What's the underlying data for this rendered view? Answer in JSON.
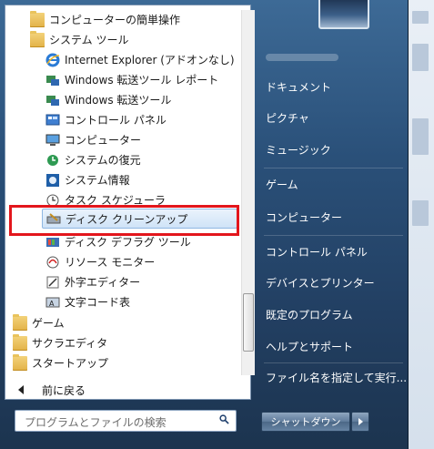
{
  "programs": {
    "items": [
      {
        "label": "コンピューターの簡単操作",
        "icon": "folder-icon"
      },
      {
        "label": "システム ツール",
        "icon": "folder-icon"
      },
      {
        "label": "Internet Explorer (アドオンなし)",
        "icon": "internet-explorer-icon"
      },
      {
        "label": "Windows 転送ツール レポート",
        "icon": "transfer-report-icon"
      },
      {
        "label": "Windows 転送ツール",
        "icon": "transfer-tool-icon"
      },
      {
        "label": "コントロール パネル",
        "icon": "control-panel-icon"
      },
      {
        "label": "コンピューター",
        "icon": "computer-icon"
      },
      {
        "label": "システムの復元",
        "icon": "system-restore-icon"
      },
      {
        "label": "システム情報",
        "icon": "system-info-icon"
      },
      {
        "label": "タスク スケジューラ",
        "icon": "task-scheduler-icon"
      },
      {
        "label": "ディスク クリーンアップ",
        "icon": "disk-cleanup-icon"
      },
      {
        "label": "ディスク デフラグ ツール",
        "icon": "defrag-icon"
      },
      {
        "label": "リソース モニター",
        "icon": "resource-monitor-icon"
      },
      {
        "label": "外字エディター",
        "icon": "char-editor-icon"
      },
      {
        "label": "文字コード表",
        "icon": "char-map-icon"
      },
      {
        "label": "ゲーム",
        "icon": "folder-icon"
      },
      {
        "label": "サクラエディタ",
        "icon": "folder-icon"
      },
      {
        "label": "スタートアップ",
        "icon": "folder-icon"
      }
    ],
    "back_label": "前に戻る"
  },
  "search": {
    "placeholder": "プログラムとファイルの検索"
  },
  "right_menu": {
    "items": [
      "ドキュメント",
      "ピクチャ",
      "ミュージック",
      "ゲーム",
      "コンピューター",
      "コントロール パネル",
      "デバイスとプリンター",
      "既定のプログラム",
      "ヘルプとサポート",
      "ファイル名を指定して実行..."
    ]
  },
  "shutdown": {
    "label": "シャットダウン"
  },
  "colors": {
    "highlight_border": "#e3161c",
    "frame": "#2a5079"
  }
}
